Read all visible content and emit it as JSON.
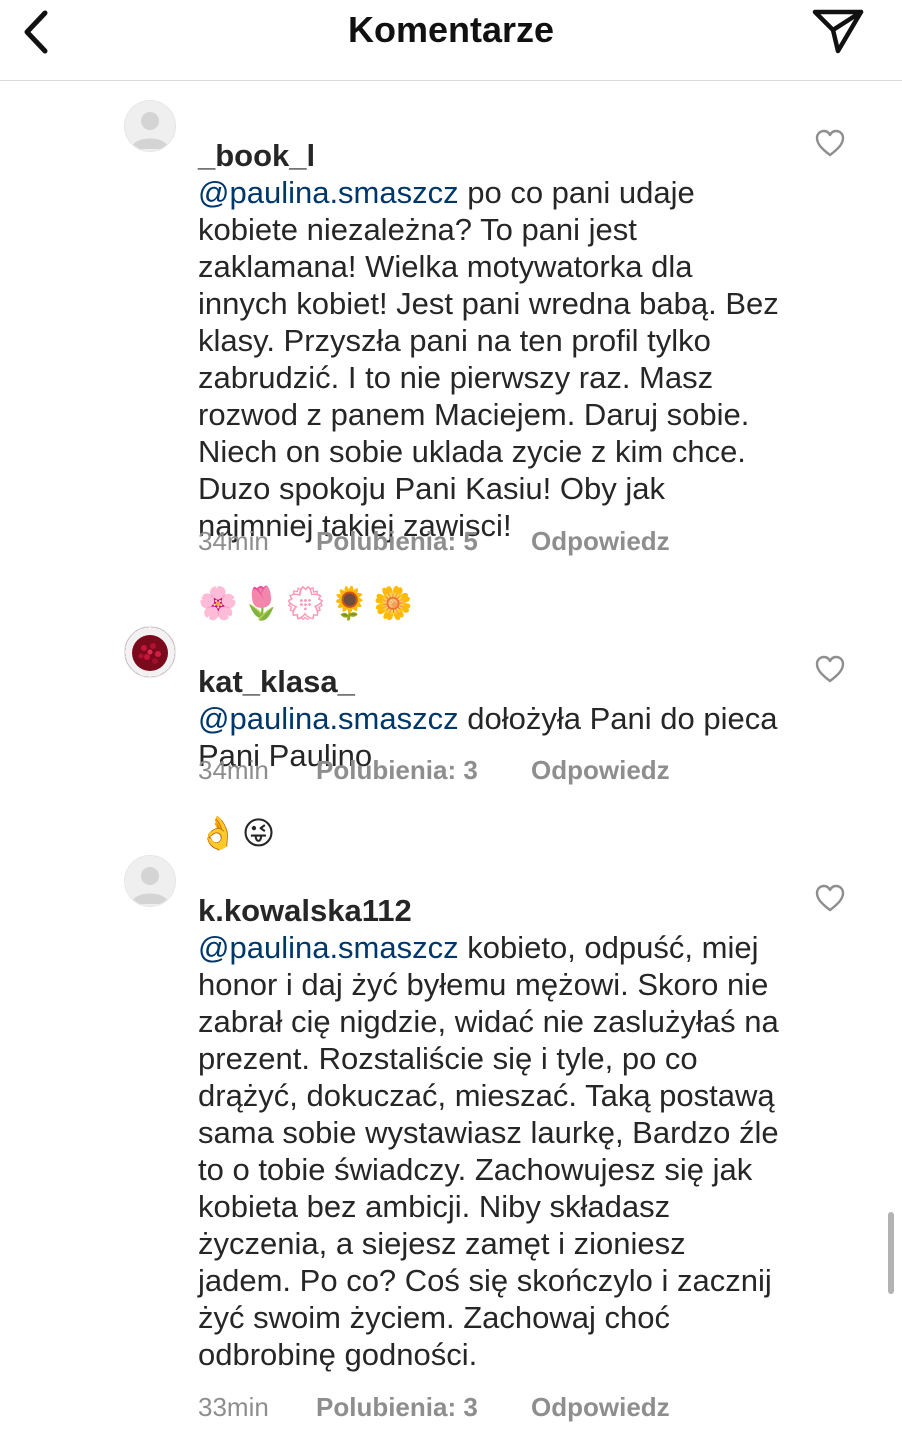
{
  "header": {
    "title": "Komentarze"
  },
  "comments": [
    {
      "username": "_book_l",
      "mention": "@paulina.smaszcz",
      "text": " po co pani udaje kobiete niezależna? To pani jest zaklamana! Wielka motywatorka dla innych kobiet! Jest pani wredna babą. Bez klasy. Przyszła pani na ten profil tylko zabrudzić. I to nie pierwszy raz. Masz rozwod z panem Maciejem. Daruj sobie. Niech on sobie uklada zycie z kim chce. Duzo spokoju Pani Kasiu! Oby jak najmniej takiej zawisci!",
      "emojis": "🌸🌷💮🌻🌼",
      "time": "34min",
      "likes": "Polubienia: 5",
      "reply": "Odpowiedz"
    },
    {
      "username": "kat_klasa_",
      "mention": "@paulina.smaszcz",
      "text": " dołożyła Pani do pieca Pani Paulino",
      "emojis": "👌😜",
      "time": "34min",
      "likes": "Polubienia: 3",
      "reply": "Odpowiedz"
    },
    {
      "username": "k.kowalska112",
      "mention": "@paulina.smaszcz",
      "text": " kobieto, odpuść, miej honor i daj żyć byłemu mężowi. Skoro nie zabrał cię nigdzie, widać nie zaslużyłaś na prezent. Rozstaliście się i tyle, po co drążyć, dokuczać, mieszać. Taką postawą sama sobie wystawiasz laurkę, Bardzo źle to o tobie świadczy. Zachowujesz się jak kobieta bez ambicji. Niby składasz życzenia, a siejesz zamęt i zioniesz jadem. Po co? Coś się skończylo i zacznij żyć swoim życiem. Zachowaj choć odbrobinę godności.",
      "emojis": "",
      "time": "33min",
      "likes": "Polubienia: 3",
      "reply": "Odpowiedz"
    }
  ],
  "icons": {
    "back": "chevron-left-icon",
    "share": "paper-plane-icon",
    "like": "heart-outline-icon",
    "avatar_default": "default-avatar-icon"
  }
}
